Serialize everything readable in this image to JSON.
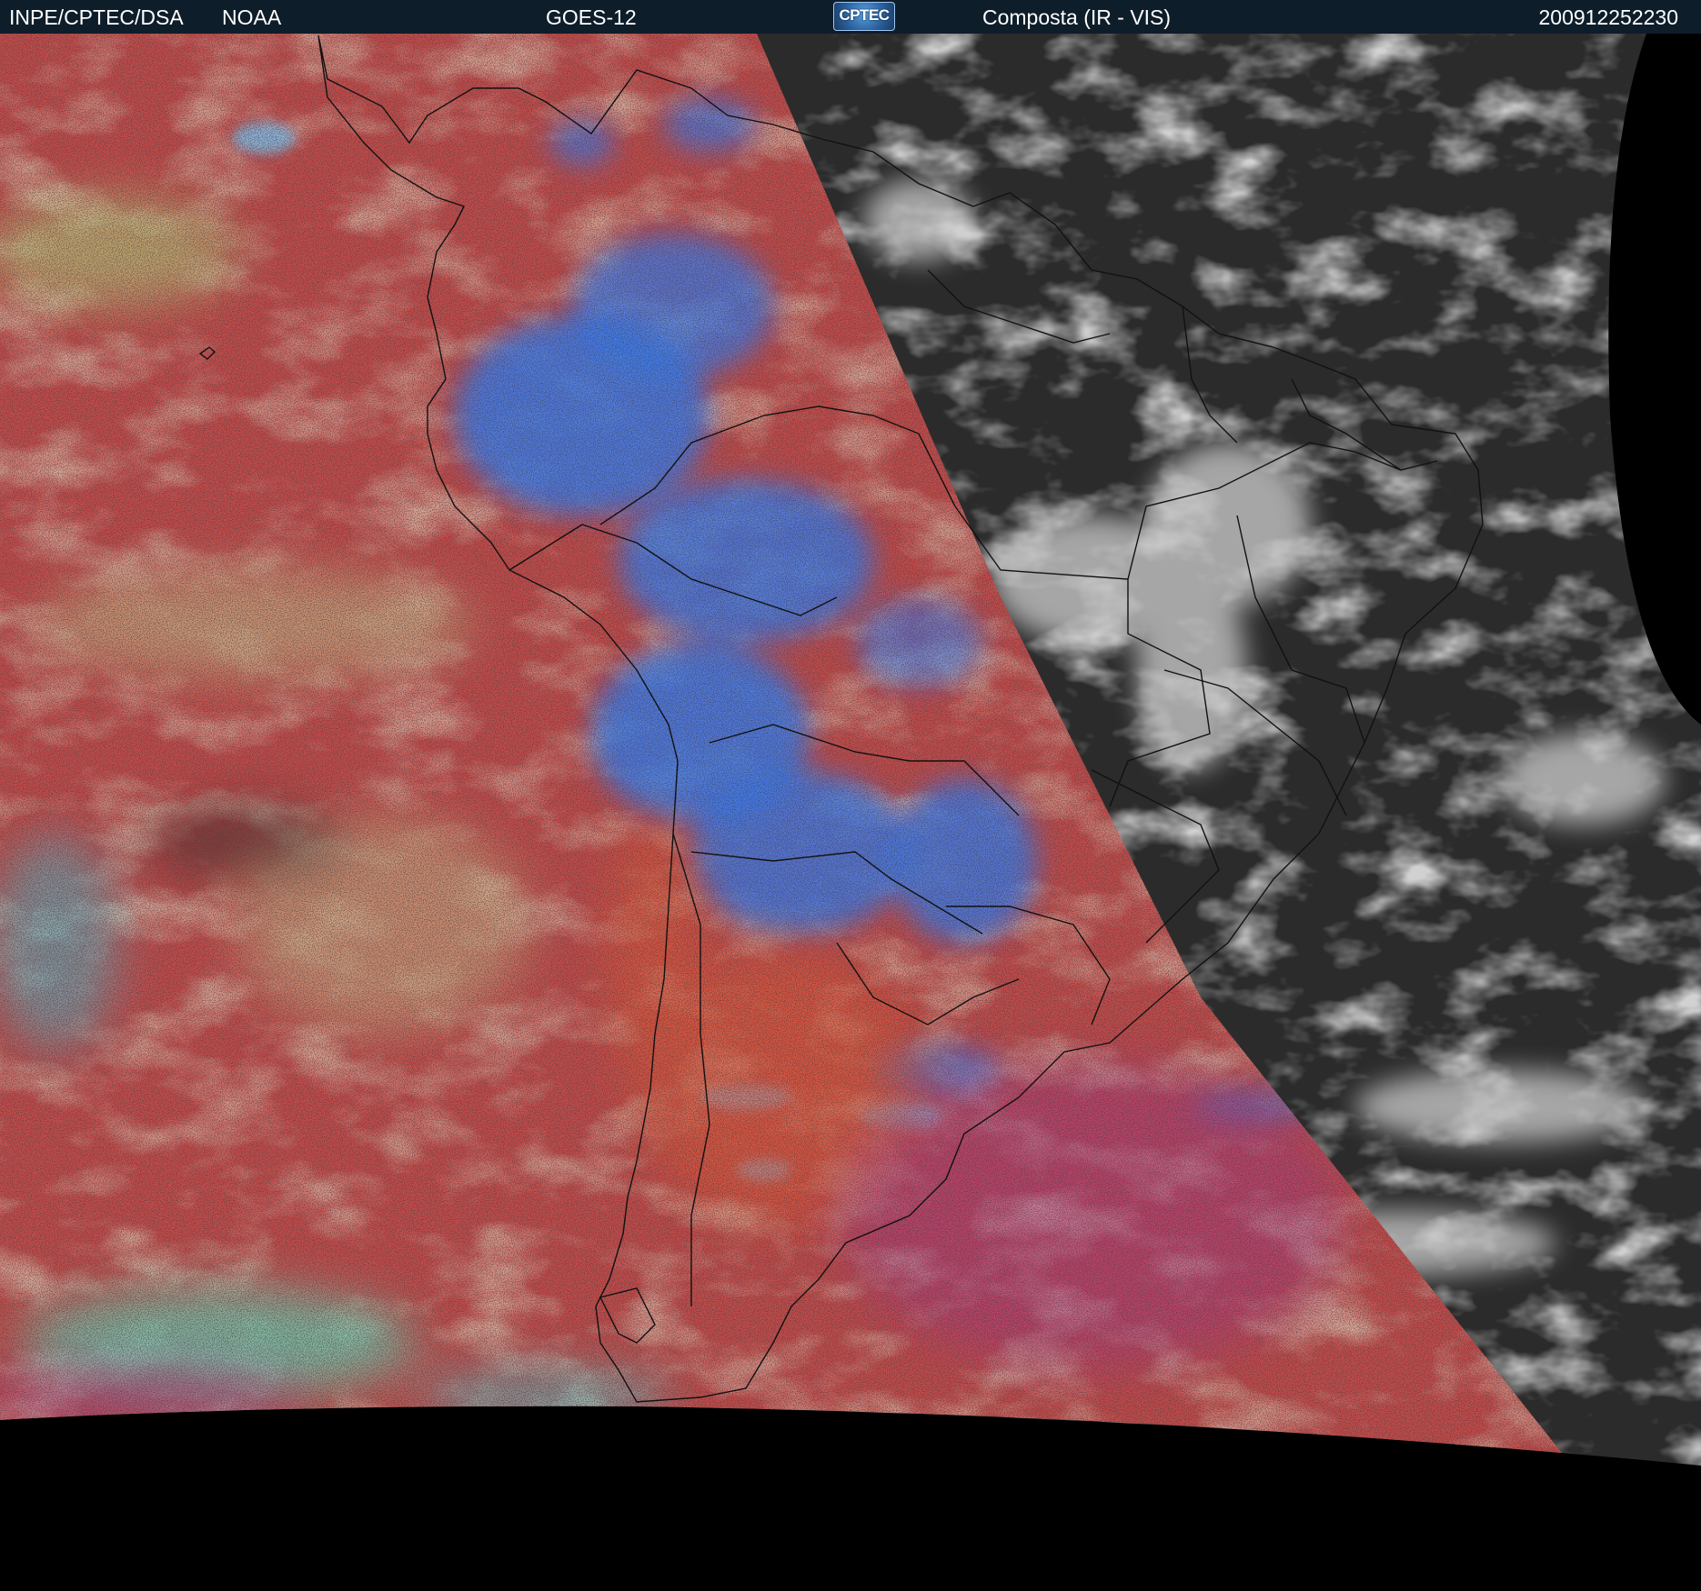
{
  "header": {
    "organization": "INPE/CPTEC/DSA",
    "agency": "NOAA",
    "satellite": "GOES-12",
    "logo_text": "CPTEC",
    "product": "Composta (IR - VIS)",
    "timestamp": "200912252230"
  },
  "colors": {
    "header_background": "#0e1d2a",
    "ir_warm_surface": "#c24a4a",
    "ir_low_cloud": "#c7a07a",
    "ir_mid_cloud": "#6ad6b8",
    "ir_high_cloud": "#3a7cf0",
    "vis_background": "#2b2b2b",
    "vis_cloud": "#d8d8d8",
    "space": "#000000"
  }
}
